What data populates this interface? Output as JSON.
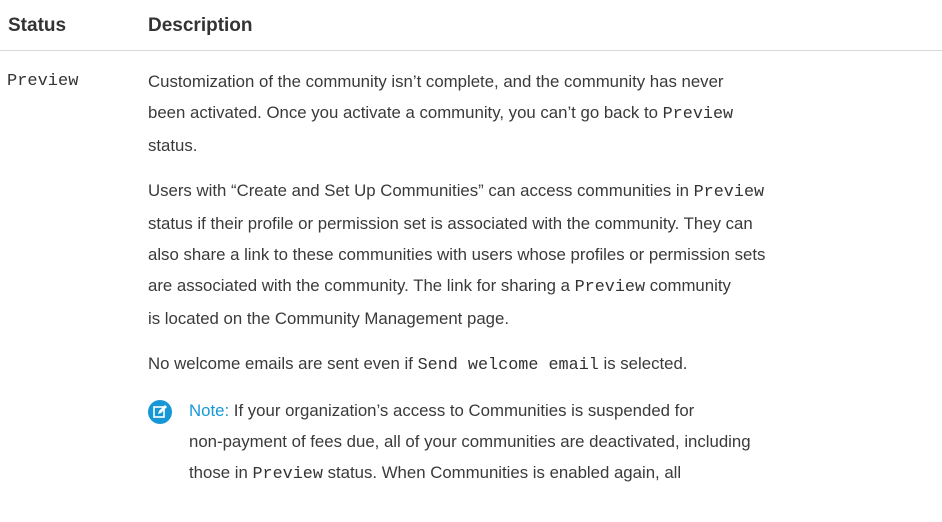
{
  "table": {
    "headers": {
      "status": "Status",
      "description": "Description"
    },
    "row": {
      "status_value": "Preview",
      "para1": {
        "line1": "Customization of the community isn’t complete, and the community has never",
        "line2_text": "been activated. Once you activate a community, you can’t go back to ",
        "line2_code": "Preview",
        "line3": "status."
      },
      "para2": {
        "line1_text": "Users with “Create and Set Up Communities” can access communities in ",
        "line1_code": "Preview",
        "line2": "status if their profile or permission set is associated with the community. They can",
        "line3": "also share a link to these communities with users whose profiles or permission sets",
        "line4_text_a": "are associated with the community. The link for sharing a ",
        "line4_code": "Preview",
        "line4_text_b": " community",
        "line5": "is located on the Community Management page."
      },
      "para3": {
        "text_a": "No welcome emails are sent even if ",
        "code": "Send welcome email",
        "text_b": " is selected."
      },
      "note": {
        "icon": "edit-note-icon",
        "label": "Note:",
        "line1": " If your organization’s access to Communities is suspended for",
        "line2": "non-payment of fees due, all of your communities are deactivated, including",
        "line3_text_a": "those in ",
        "line3_code": "Preview",
        "line3_text_b": " status. When Communities is enabled again, all"
      }
    }
  },
  "colors": {
    "accent": "#1798d6",
    "text": "#333333",
    "divider": "#d8d8d8"
  }
}
